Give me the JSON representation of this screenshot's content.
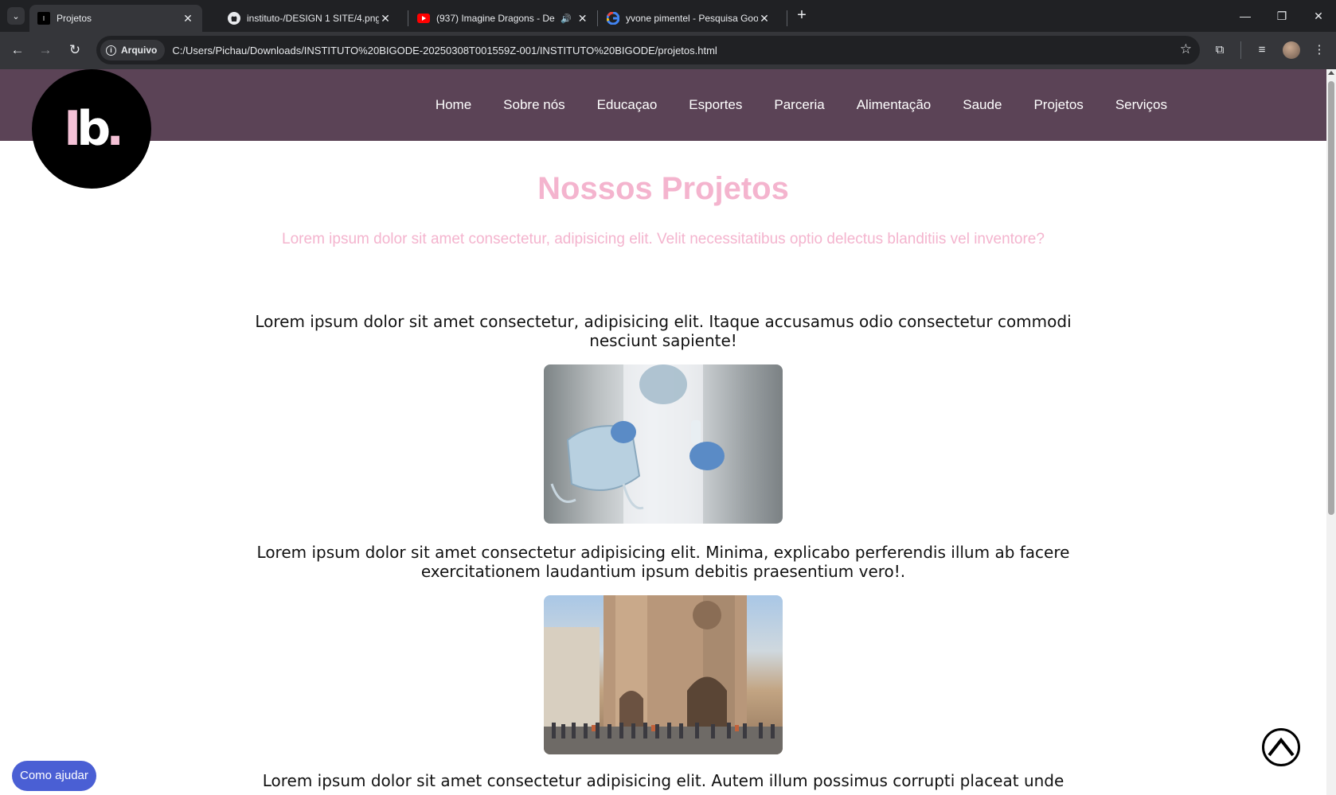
{
  "browser": {
    "tabs": [
      {
        "title": "Projetos",
        "icon": "site-favicon",
        "active": true
      },
      {
        "title": "instituto-/DESIGN 1 SITE/4.png",
        "icon": "github-icon",
        "active": false
      },
      {
        "title": "(937) Imagine Dragons - De",
        "icon": "youtube-icon",
        "active": false
      },
      {
        "title": "yvone pimentel - Pesquisa Goo",
        "icon": "google-icon",
        "active": false
      }
    ],
    "security_chip": "Arquivo",
    "url": "C:/Users/Pichau/Downloads/INSTITUTO%20BIGODE-20250308T001559Z-001/INSTITUTO%20BIGODE/projetos.html"
  },
  "site": {
    "logo_text": "IB.",
    "nav": [
      "Home",
      "Sobre nós",
      "Educaçao",
      "Esportes",
      "Parceria",
      "Alimentação",
      "Saude",
      "Projetos",
      "Serviços"
    ],
    "title": "Nossos Projetos",
    "subtitle": "Lorem ipsum dolor sit amet consectetur, adipisicing elit. Velit necessitatibus optio delectus blanditiis vel inventore?",
    "projects": [
      {
        "text": "Lorem ipsum dolor sit amet consectetur, adipisicing elit. Itaque accusamus odio consectetur commodi nesciunt sapiente!"
      },
      {
        "text": "Lorem ipsum dolor sit amet consectetur adipisicing elit. Minima, explicabo perferendis illum ab facere exercitationem laudantium ipsum debitis praesentium vero!."
      },
      {
        "text": "Lorem ipsum dolor sit amet consectetur adipisicing elit. Autem illum possimus corrupti placeat unde"
      }
    ],
    "help_button": "Como ajudar"
  },
  "colors": {
    "header_bg": "#5b4356",
    "accent_pink": "#f4b4ce",
    "help_button_bg": "#4a5fd4"
  }
}
